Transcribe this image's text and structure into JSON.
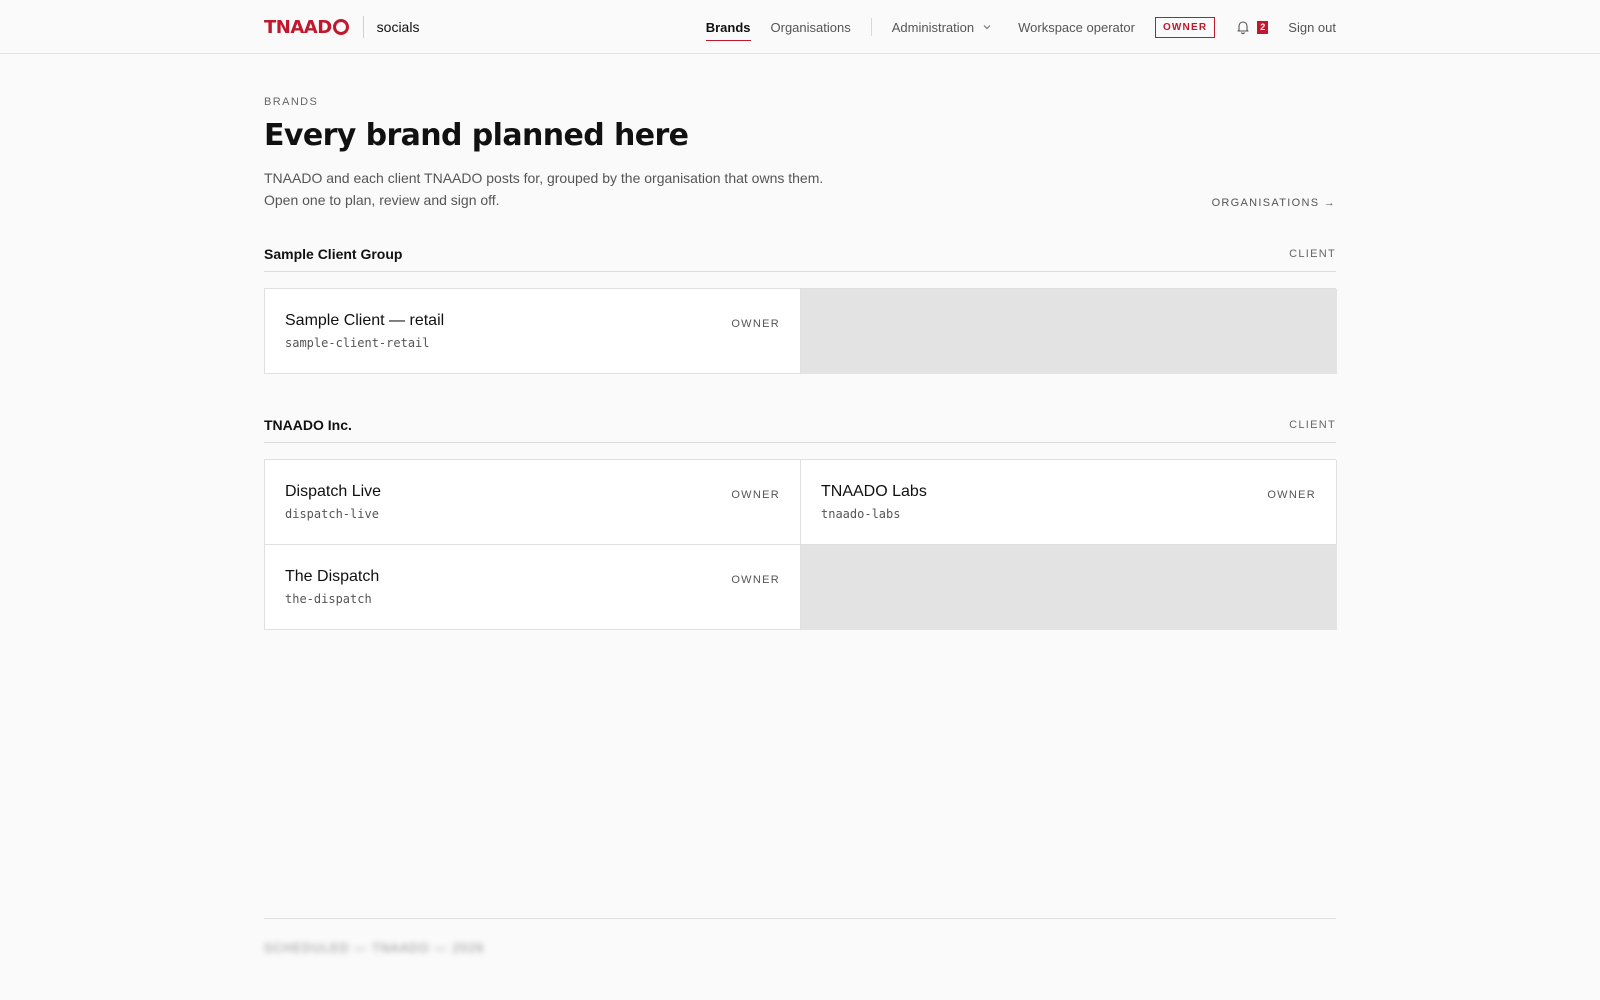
{
  "header": {
    "logo_text": "TNAAD",
    "product": "socials",
    "nav": [
      {
        "label": "Brands",
        "active": true
      },
      {
        "label": "Organisations",
        "active": false
      }
    ],
    "admin_label": "Administration",
    "operator_label": "Workspace operator",
    "role_badge": "OWNER",
    "notifications_count": "2",
    "sign_out": "Sign out"
  },
  "page": {
    "eyebrow": "BRANDS",
    "title": "Every brand planned here",
    "intro": "TNAADO and each client TNAADO posts for, grouped by the organisation that owns them. Open one to plan, review and sign off.",
    "organisations_link": "ORGANISATIONS →"
  },
  "groups": [
    {
      "name": "Sample Client Group",
      "kind": "CLIENT",
      "brands": [
        {
          "name": "Sample Client — retail",
          "slug": "sample-client-retail",
          "role": "OWNER"
        }
      ]
    },
    {
      "name": "TNAADO Inc.",
      "kind": "CLIENT",
      "brands": [
        {
          "name": "Dispatch Live",
          "slug": "dispatch-live",
          "role": "OWNER"
        },
        {
          "name": "TNAADO Labs",
          "slug": "tnaado-labs",
          "role": "OWNER"
        },
        {
          "name": "The Dispatch",
          "slug": "the-dispatch",
          "role": "OWNER"
        }
      ]
    }
  ],
  "footer": {
    "text": "SCHEDULED — TNAADO — 2026"
  },
  "colors": {
    "accent": "#c0182f",
    "background": "#fafafa",
    "filler": "#e3e3e3"
  }
}
